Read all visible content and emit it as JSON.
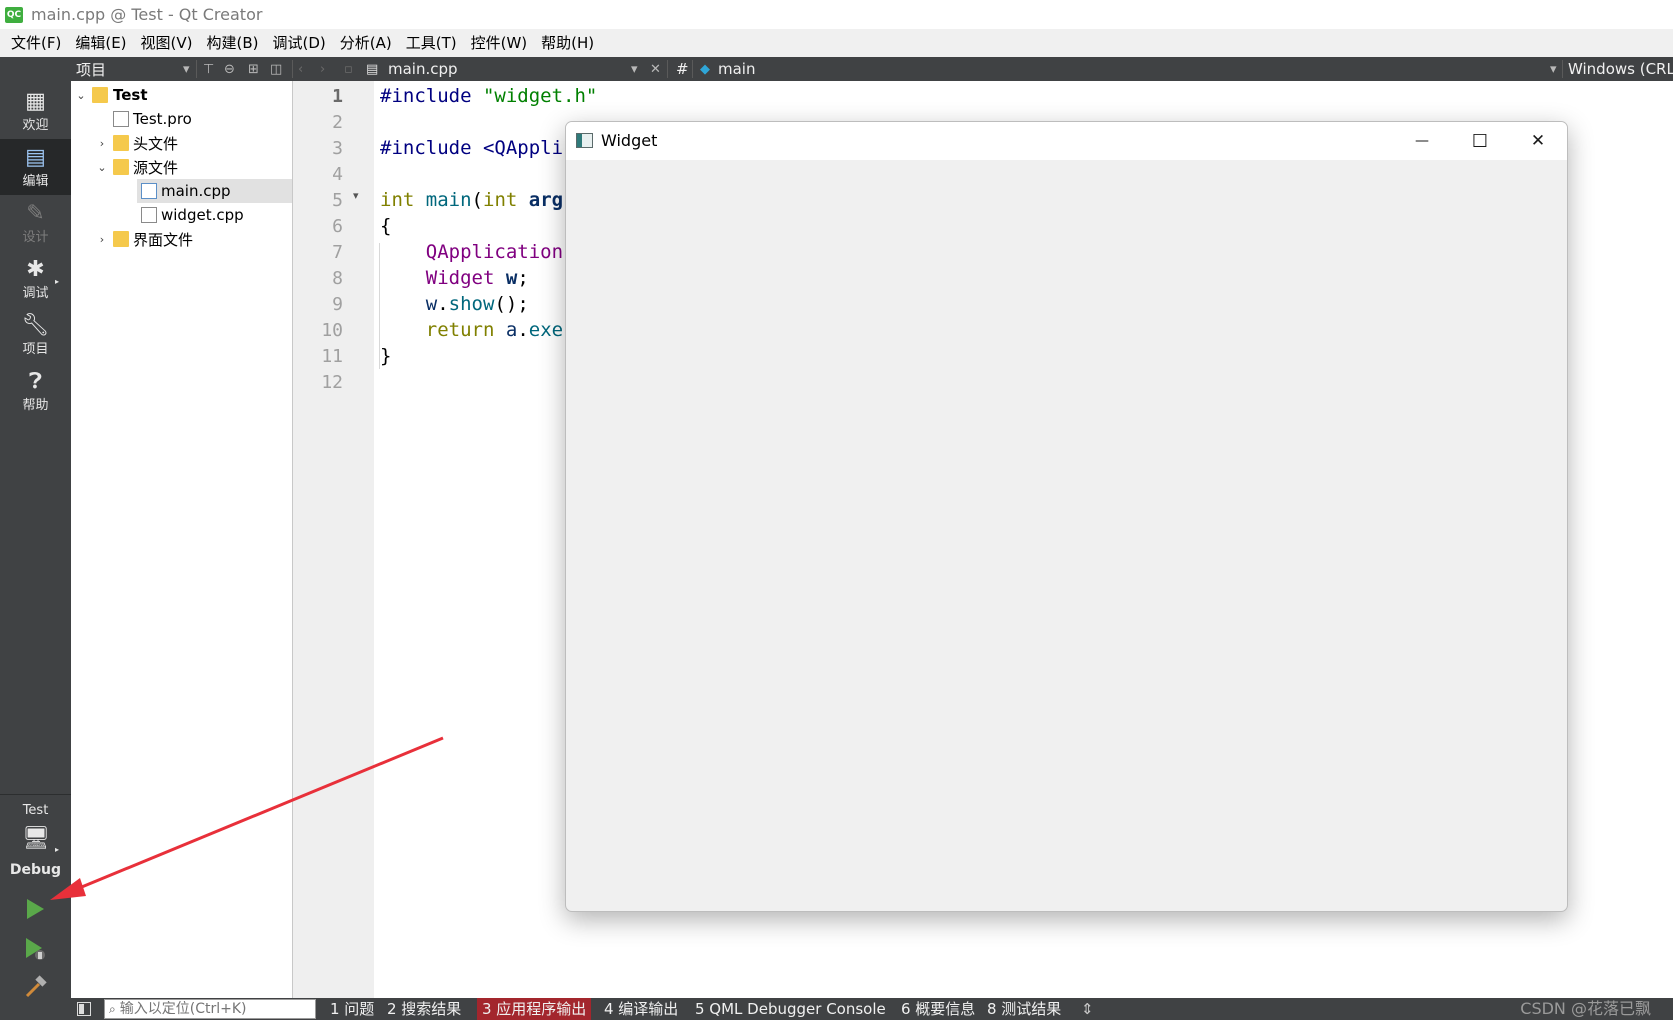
{
  "window": {
    "title": "main.cpp @ Test - Qt Creator",
    "logo_text": "QC"
  },
  "menu": [
    "文件(F)",
    "编辑(E)",
    "视图(V)",
    "构建(B)",
    "调试(D)",
    "分析(A)",
    "工具(T)",
    "控件(W)",
    "帮助(H)"
  ],
  "toolbar": {
    "panel_title": "项目",
    "open_file": "main.cpp",
    "hash": "#",
    "symbol": "main",
    "line_endings": "Windows (CRLF)"
  },
  "modes": [
    {
      "label": "欢迎",
      "icon": "grid-icon",
      "state": "normal"
    },
    {
      "label": "编辑",
      "icon": "edit-icon",
      "state": "active"
    },
    {
      "label": "设计",
      "icon": "pencil-icon",
      "state": "disabled"
    },
    {
      "label": "调试",
      "icon": "bug-icon",
      "state": "normal"
    },
    {
      "label": "项目",
      "icon": "wrench-icon",
      "state": "normal"
    },
    {
      "label": "帮助",
      "icon": "help-icon",
      "state": "normal"
    }
  ],
  "kit": {
    "project": "Test",
    "config": "Debug"
  },
  "tree": [
    {
      "label": "Test",
      "type": "project",
      "expanded": true
    },
    {
      "label": "Test.pro",
      "type": "pro-file"
    },
    {
      "label": "头文件",
      "type": "folder",
      "expanded": false
    },
    {
      "label": "源文件",
      "type": "folder",
      "expanded": true
    },
    {
      "label": "main.cpp",
      "type": "cpp-file",
      "selected": true
    },
    {
      "label": "widget.cpp",
      "type": "cpp-file"
    },
    {
      "label": "界面文件",
      "type": "folder",
      "expanded": false
    }
  ],
  "editor": {
    "line_numbers": [
      "1",
      "2",
      "3",
      "4",
      "5",
      "6",
      "7",
      "8",
      "9",
      "10",
      "11",
      "12"
    ],
    "current_line": 1,
    "lines": [
      "#include \"widget.h\"",
      "",
      "#include <QAppli",
      "",
      "int main(int arg",
      "{",
      "    QApplication",
      "    Widget w;",
      "    w.show();",
      "    return a.exe",
      "}",
      ""
    ]
  },
  "widget_window": {
    "title": "Widget",
    "minimize": "—",
    "maximize": "☐",
    "close": "✕"
  },
  "statusbar": {
    "locator_placeholder": "输入以定位(Ctrl+K)",
    "tabs": [
      "1 问题",
      "2 搜索结果",
      "3 应用程序输出",
      "4 编译输出",
      "5 QML Debugger Console",
      "6 概要信息",
      "8 测试结果"
    ],
    "active_tab": "3 应用程序输出",
    "more": "⇕",
    "watermark": "CSDN @花落已飘"
  },
  "colors": {
    "sidebar": "#404244",
    "active_mode": "#262829",
    "active_output_tab": "#a3262d",
    "run_green": "#5aa84a",
    "annotation_arrow": "#e8303a"
  }
}
